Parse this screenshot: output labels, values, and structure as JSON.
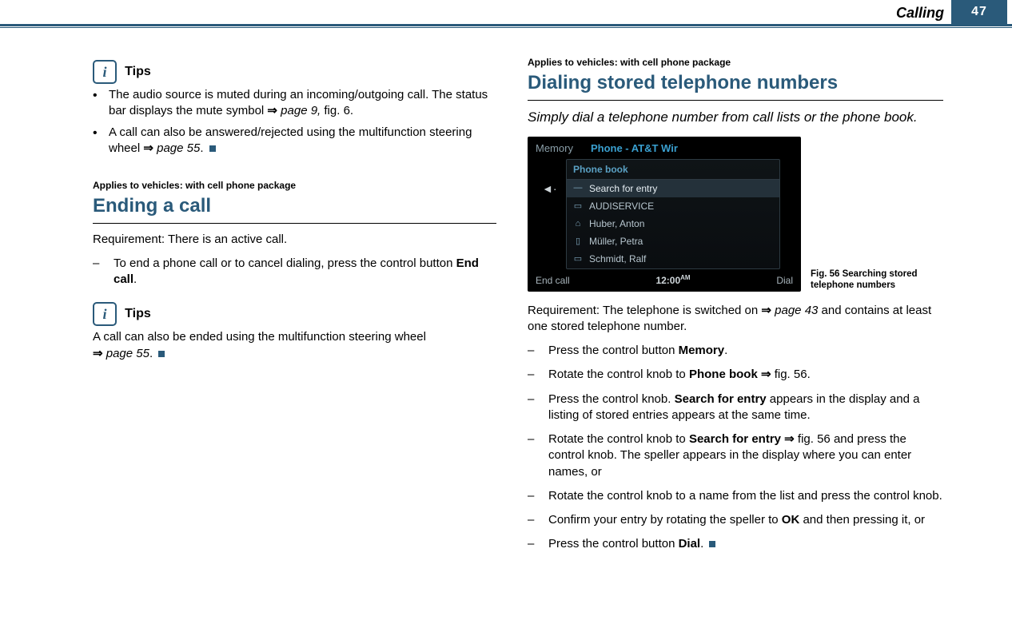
{
  "header": {
    "title": "Calling",
    "page_number": "47"
  },
  "left": {
    "tips_label": "Tips",
    "tip1_a": "The audio source is muted during an incoming/outgoing call. The status bar displays the mute symbol ",
    "tip1_ref": "page 9,",
    "tip1_b": " fig. 6.",
    "tip2_a": "A call can also be answered/rejected using the multifunction steering wheel ",
    "tip2_ref": "page 55",
    "tip2_b": ".",
    "applies": "Applies to vehicles: with cell phone package",
    "heading": "Ending a call",
    "req": "Requirement: There is an active call.",
    "step1_a": "To end a phone call or to cancel dialing, press the control button ",
    "step1_bold": "End call",
    "step1_b": ".",
    "tips2_label": "Tips",
    "tips2_body_a": "A call can also be ended using the multifunction steering wheel ",
    "tips2_ref": "page 55",
    "tips2_body_b": "."
  },
  "right": {
    "applies": "Applies to vehicles: with cell phone package",
    "heading": "Dialing stored telephone numbers",
    "lede": "Simply dial a telephone number from call lists or the phone book.",
    "fig": {
      "top_memory": "Memory",
      "top_phone": "Phone - AT&T Wir",
      "panel_title": "Phone book",
      "row_search": "Search for entry",
      "row1": "AUDISERVICE",
      "row2": "Huber, Anton",
      "row3": "Müller, Petra",
      "row4": "Schmidt, Ralf",
      "bottom_left": "End call",
      "clock": "12:00",
      "clock_sfx": "AM",
      "bottom_right": "Dial",
      "caption": "Fig. 56   Searching stored telephone numbers"
    },
    "req_a": "Requirement: The telephone is switched on ",
    "req_ref": "page 43",
    "req_b": " and contains at least one stored telephone number.",
    "s1_a": "Press the control button ",
    "s1_bold": "Memory",
    "s1_b": ".",
    "s2_a": "Rotate the control knob to ",
    "s2_bold": "Phone book",
    "s2_b": " fig. 56.",
    "s3_a": "Press the control knob. ",
    "s3_bold": "Search for entry",
    "s3_b": " appears in the display and a listing of stored entries appears at the same time.",
    "s4_a": "Rotate the control knob to ",
    "s4_bold": "Search for entry",
    "s4_b": " fig. 56 and press the control knob. The speller appears in the display where you can enter names, or",
    "s5": "Rotate the control knob to a name from the list and press the control knob.",
    "s6_a": "Confirm your entry by rotating the speller to ",
    "s6_bold": "OK",
    "s6_b": " and then pressing it, or",
    "s7_a": "Press the control button ",
    "s7_bold": "Dial",
    "s7_b": "."
  }
}
